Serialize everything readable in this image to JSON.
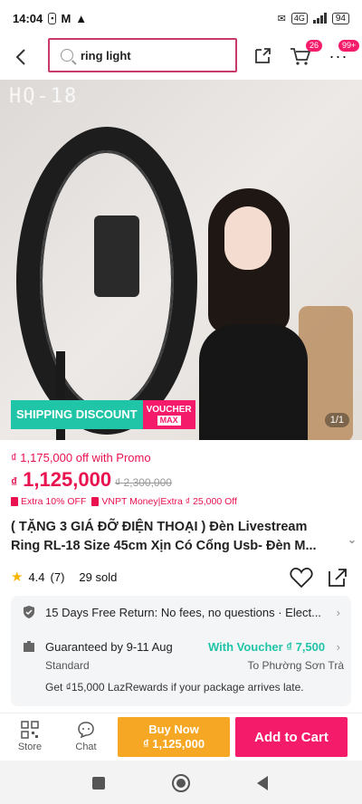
{
  "status_bar": {
    "time": "14:04",
    "network": "4G",
    "battery": "94"
  },
  "header": {
    "search": {
      "value": "ring light"
    },
    "cart_count": "26",
    "more_count": "99+"
  },
  "hero": {
    "watermark": "HQ-18",
    "shipping_discount": "SHIPPING DISCOUNT",
    "voucher_top": "VOUCHER",
    "voucher_max": "MAX",
    "image_counter": "1/1"
  },
  "price": {
    "promo_line": "₫ 1,175,000 off with Promo",
    "currency": "₫",
    "current": "1,125,000",
    "original": "₫ 2,300,000",
    "tags": [
      "Extra 10% OFF",
      "VNPT Money|Extra ₫ 25,000 Off"
    ]
  },
  "product": {
    "title": "( TẶNG 3 GIÁ ĐỠ ĐIỆN THOẠI ) Đèn Livestream Ring RL-18 Size 45cm Xịn Có Cổng Usb- Đèn M...",
    "rating": "4.4",
    "review_count": "(7)",
    "sold": "29 sold"
  },
  "info": {
    "return_policy": "15 Days Free Return: No fees, no questions · Elect...",
    "guarantee": "Guaranteed by 9-11 Aug",
    "voucher_offer": "With Voucher ₫ 7,500",
    "shipping_type": "Standard",
    "destination": "To Phường Sơn Trà",
    "rewards": "Get ₫15,000 LazRewards if your package arrives late."
  },
  "bottom_bar": {
    "store_label": "Store",
    "chat_label": "Chat",
    "buy_now_label": "Buy Now",
    "buy_now_price": "₫ 1,125,000",
    "add_to_cart_label": "Add to Cart"
  },
  "colors": {
    "accent_pink": "#f41b6a",
    "buy_orange": "#f6a724",
    "teal": "#20c4a6"
  }
}
